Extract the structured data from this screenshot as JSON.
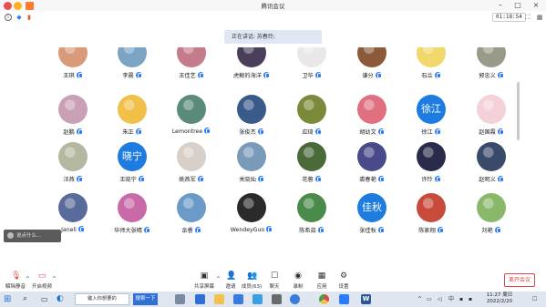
{
  "window": {
    "title": "腾讯会议"
  },
  "topbar": {
    "timer": "01:18:54"
  },
  "speaking": {
    "label": "正在讲话: 苏春玲;"
  },
  "participants": [
    {
      "name": "王琪",
      "avatar_color": "#d99a7a"
    },
    {
      "name": "李晨",
      "avatar_color": "#7aa3c4"
    },
    {
      "name": "王佳艺",
      "avatar_color": "#c47b8a"
    },
    {
      "name": "虎鲸的海洋",
      "avatar_color": "#4a3f5a"
    },
    {
      "name": "卫华",
      "avatar_color": "#e8e8e8"
    },
    {
      "name": "谦分",
      "avatar_color": "#8a5a3a"
    },
    {
      "name": "石兰",
      "avatar_color": "#f0d86a"
    },
    {
      "name": "郭忠义",
      "avatar_color": "#9a9a8a"
    },
    {
      "name": "赵鹏",
      "avatar_color": "#c9a0b6"
    },
    {
      "name": "朱正",
      "avatar_color": "#f0c048"
    },
    {
      "name": "Lemontree",
      "avatar_color": "#5a8a7a"
    },
    {
      "name": "张俊杰",
      "avatar_color": "#3a5a8a"
    },
    {
      "name": "应琦",
      "avatar_color": "#7a8a3a"
    },
    {
      "name": "胡幼文",
      "avatar_color": "#e07080"
    },
    {
      "name": "徐江",
      "avatar_color": "#1e7be0",
      "initials": "徐江"
    },
    {
      "name": "赵国霞",
      "avatar_color": "#f4d0d8"
    },
    {
      "name": "汪燕",
      "avatar_color": "#b5b8a0"
    },
    {
      "name": "王晓宁",
      "avatar_color": "#1e7be0",
      "initials": "晓宁"
    },
    {
      "name": "姚燕军",
      "avatar_color": "#d8d0c8"
    },
    {
      "name": "关晓灿",
      "avatar_color": "#7a9aba"
    },
    {
      "name": "花蓉",
      "avatar_color": "#4a6a3a"
    },
    {
      "name": "裘春艳",
      "avatar_color": "#4a4a8a"
    },
    {
      "name": "许玲",
      "avatar_color": "#2a2a4a"
    },
    {
      "name": "赵明义",
      "avatar_color": "#3a4a6a"
    },
    {
      "name": "Janeli",
      "avatar_color": "#5a6a9a"
    },
    {
      "name": "华师大张晴",
      "avatar_color": "#c86aa8"
    },
    {
      "name": "余睿",
      "avatar_color": "#6a9ac8"
    },
    {
      "name": "WendeyGuo",
      "avatar_color": "#2a2a2a"
    },
    {
      "name": "陈希茹",
      "avatar_color": "#4a8a4a"
    },
    {
      "name": "张佳秋",
      "avatar_color": "#1e7be0",
      "initials": "佳秋"
    },
    {
      "name": "陈家翔",
      "avatar_color": "#c84a3a"
    },
    {
      "name": "刘艳",
      "avatar_color": "#8ab86a"
    }
  ],
  "chat": {
    "placeholder": "说点什么..."
  },
  "toolbar": {
    "mute_label": "解除静音",
    "video_label": "开启视频",
    "share_label": "共享屏幕",
    "invite_label": "邀请",
    "members_label": "成员(63)",
    "chat_label": "聊天",
    "record_label": "录制",
    "apps_label": "应用",
    "settings_label": "设置",
    "leave_label": "离开会议"
  },
  "taskbar": {
    "search_placeholder": "键入你想要的",
    "search_button": "搜索一下",
    "time": "11:27 周日",
    "date": "2022/2/20",
    "lang": "中"
  }
}
